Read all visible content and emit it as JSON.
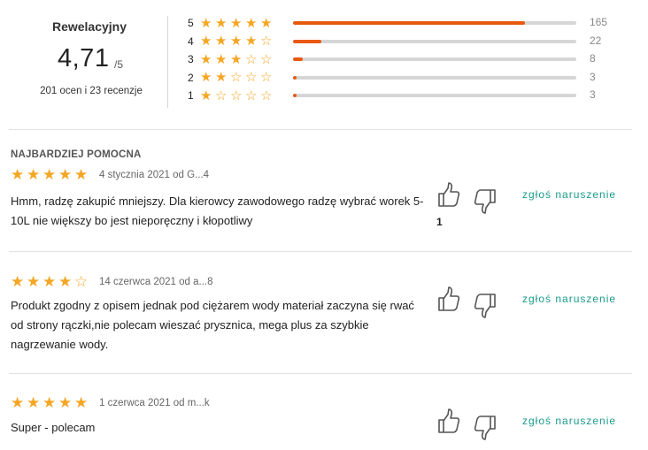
{
  "summary": {
    "label": "Rewelacyjny",
    "score": "4,71",
    "score_max": "/5",
    "count_text": "201 ocen i 23 recenzje",
    "distribution": [
      {
        "stars": "5",
        "count": "165",
        "fraction": 0.82
      },
      {
        "stars": "4",
        "count": "22",
        "fraction": 0.1
      },
      {
        "stars": "3",
        "count": "8",
        "fraction": 0.035
      },
      {
        "stars": "2",
        "count": "3",
        "fraction": 0.012
      },
      {
        "stars": "1",
        "count": "3",
        "fraction": 0.012
      }
    ]
  },
  "colors": {
    "star": "#f5a623",
    "bar_fill": "#e8590c",
    "bar_track": "#d6d6d6",
    "report_link": "#1a9a8c"
  },
  "reviews": [
    {
      "badge": "NAJBARDZIEJ POMOCNA",
      "rating": 5,
      "meta": "4 stycznia 2021 od G...4",
      "text": "Hmm, radzę zakupić mniejszy. Dla kierowcy zawodowego radzę wybrać worek 5-10L nie większy bo jest nieporęczny i kłopotliwy",
      "helpful_count": "1",
      "report": "zgłoś naruszenie"
    },
    {
      "badge": "",
      "rating": 4,
      "meta": "14 czerwca 2021 od a...8",
      "text": "Produkt zgodny z opisem jednak pod ciężarem wody materiał zaczyna się rwać od strony rączki,nie polecam wieszać prysznica, mega plus za szybkie nagrzewanie wody.",
      "helpful_count": "",
      "report": "zgłoś naruszenie"
    },
    {
      "badge": "",
      "rating": 5,
      "meta": "1 czerwca 2021 od m...k",
      "text": "Super - polecam",
      "helpful_count": "",
      "report": "zgłoś naruszenie"
    }
  ],
  "icons": {
    "filled_star": "★",
    "empty_star": "☆",
    "thumb_up": "thumbs-up-icon",
    "thumb_down": "thumbs-down-icon"
  }
}
